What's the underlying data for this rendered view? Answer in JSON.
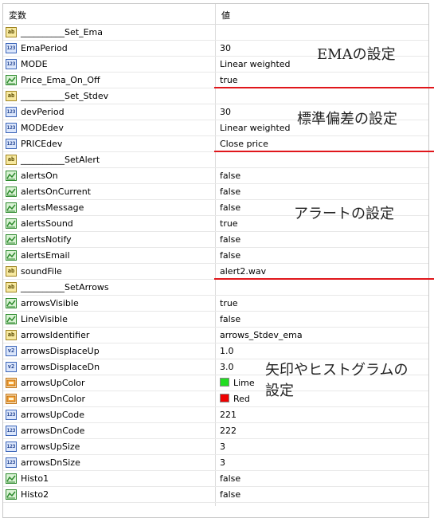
{
  "header": {
    "col_name": "変数",
    "col_value": "値"
  },
  "colors": {
    "red_line": "#e0161b",
    "lime": "#22dd22",
    "red": "#ee0000"
  },
  "rows": [
    {
      "type": "ab",
      "name": "__________Set_Ema",
      "value": ""
    },
    {
      "type": "123",
      "name": "EmaPeriod",
      "value": "30"
    },
    {
      "type": "123",
      "name": "MODE",
      "value": "Linear weighted"
    },
    {
      "type": "bool",
      "name": "Price_Ema_On_Off",
      "value": "true"
    },
    {
      "type": "ab",
      "name": "__________Set_Stdev",
      "value": ""
    },
    {
      "type": "123",
      "name": "devPeriod",
      "value": "30"
    },
    {
      "type": "123",
      "name": "MODEdev",
      "value": "Linear weighted"
    },
    {
      "type": "123",
      "name": "PRICEdev",
      "value": "Close price"
    },
    {
      "type": "ab",
      "name": "__________SetAlert",
      "value": ""
    },
    {
      "type": "bool",
      "name": "alertsOn",
      "value": "false"
    },
    {
      "type": "bool",
      "name": "alertsOnCurrent",
      "value": "false"
    },
    {
      "type": "bool",
      "name": "alertsMessage",
      "value": "false"
    },
    {
      "type": "bool",
      "name": "alertsSound",
      "value": "true"
    },
    {
      "type": "bool",
      "name": "alertsNotify",
      "value": "false"
    },
    {
      "type": "bool",
      "name": "alertsEmail",
      "value": "false"
    },
    {
      "type": "ab",
      "name": "soundFile",
      "value": "alert2.wav"
    },
    {
      "type": "ab",
      "name": "__________SetArrows",
      "value": ""
    },
    {
      "type": "bool",
      "name": "arrowsVisible",
      "value": "true"
    },
    {
      "type": "bool",
      "name": "LineVisible",
      "value": "false"
    },
    {
      "type": "ab",
      "name": "arrowsIdentifier",
      "value": "arrows_Stdev_ema"
    },
    {
      "type": "v2",
      "name": "arrowsDisplaceUp",
      "value": "1.0"
    },
    {
      "type": "v2",
      "name": "arrowsDisplaceDn",
      "value": "3.0"
    },
    {
      "type": "color",
      "name": "arrowsUpColor",
      "value": "Lime",
      "swatch": "#22dd22"
    },
    {
      "type": "color",
      "name": "arrowsDnColor",
      "value": "Red",
      "swatch": "#ee0000"
    },
    {
      "type": "123",
      "name": "arrowsUpCode",
      "value": "221"
    },
    {
      "type": "123",
      "name": "arrowsDnCode",
      "value": "222"
    },
    {
      "type": "123",
      "name": "arrowsUpSize",
      "value": "3"
    },
    {
      "type": "123",
      "name": "arrowsDnSize",
      "value": "3"
    },
    {
      "type": "bool",
      "name": "Histo1",
      "value": "false"
    },
    {
      "type": "bool",
      "name": "Histo2",
      "value": "false"
    }
  ],
  "annotations": {
    "ema": "EMAの設定",
    "stdev": "標準偏差の設定",
    "alert": "アラートの設定",
    "arrows_line1": "矢印やヒストグラムの",
    "arrows_line2": "設定"
  }
}
